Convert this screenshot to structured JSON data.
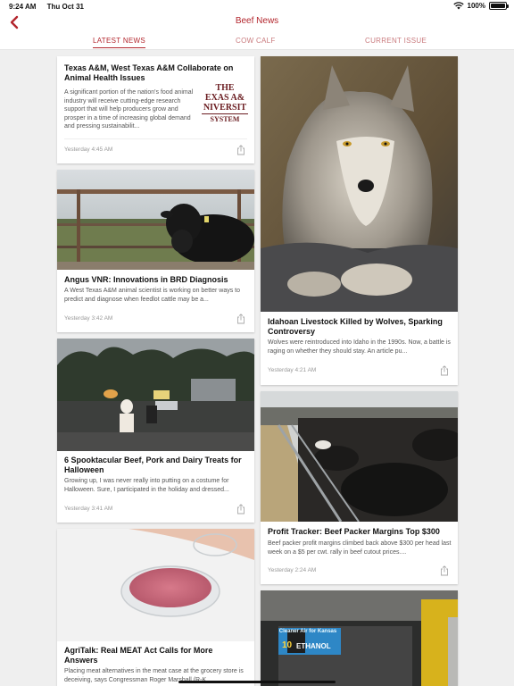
{
  "status_bar": {
    "time": "9:24 AM",
    "date": "Thu Oct 31",
    "battery": "100%"
  },
  "nav": {
    "title": "Beef News"
  },
  "tabs": [
    {
      "label": "LATEST NEWS",
      "active": true
    },
    {
      "label": "COW CALF",
      "active": false
    },
    {
      "label": "CURRENT ISSUE",
      "active": false
    }
  ],
  "colors": {
    "accent": "#b3262d"
  },
  "articles": [
    {
      "title": "Texas A&M, West Texas A&M Collaborate on Animal Health Issues",
      "excerpt": "A significant portion of the nation's food animal industry will receive cutting-edge research support that will help producers grow and prosper in a time of increasing global demand and pressing sustainabilit...",
      "time": "Yesterday 4:45 AM",
      "logo": [
        "THE",
        "EXAS A&",
        "NIVERSIT",
        "SYSTEM"
      ]
    },
    {
      "title": "Angus VNR: Innovations in BRD Diagnosis",
      "excerpt": "A West Texas A&M animal scientist is working on better ways to predict and diagnose when feedlot cattle may be a...",
      "time": "Yesterday 3:42 AM"
    },
    {
      "title": "Idahoan Livestock Killed by Wolves, Sparking Controversy",
      "excerpt": "Wolves were reintroduced into Idaho in the 1990s. Now, a battle is raging on whether they should stay. An article pu...",
      "time": "Yesterday 4:21 AM"
    },
    {
      "title": "6 Spooktacular Beef, Pork and Dairy Treats for Halloween",
      "excerpt": "Growing up, I was never really into putting on a costume for Halloween. Sure, I participated in the holiday and dressed...",
      "time": "Yesterday 3:41 AM"
    },
    {
      "title": "Profit Tracker: Beef Packer Margins Top $300",
      "excerpt": "Beef packer profit margins climbed back above $300 per head last week on a $5 per cwt. rally in beef cutout prices....",
      "time": "Yesterday 2:24 AM"
    },
    {
      "title": "AgriTalk: Real MEAT Act Calls for More Answers",
      "excerpt": "Placing meat alternatives in the meat case at the grocery store is deceiving, says Congressman Roger Marshall (R-K..."
    },
    {
      "image_text": [
        "Cleaner Air for Kansas",
        "10",
        "ETHANOL"
      ]
    }
  ]
}
